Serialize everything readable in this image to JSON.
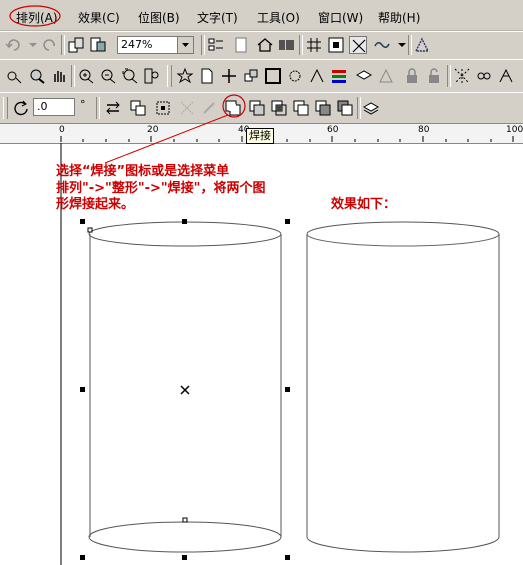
{
  "menu": [
    {
      "label": "排列(A)"
    },
    {
      "label": "效果(C)"
    },
    {
      "label": "位图(B)"
    },
    {
      "label": "文字(T)"
    },
    {
      "label": "工具(O)"
    },
    {
      "label": "窗口(W)"
    },
    {
      "label": "帮助(H)"
    }
  ],
  "toolbar": {
    "zoom_value": "247%",
    "rotation_value": ".0",
    "degree_symbol": "°"
  },
  "ruler": {
    "ticks": [
      "0",
      "20",
      "40",
      "60",
      "80",
      "100"
    ]
  },
  "tooltip": "焊接",
  "annotation": {
    "line1": "选择“焊接”图标或是选择菜单",
    "line2": "排列\"->\"整形\"->\"焊接\"，将两个图",
    "line3": "形焊接起来。",
    "result": "效果如下："
  },
  "colors": {
    "highlight": "#cc0000",
    "ui_face": "#d4d0c8"
  }
}
